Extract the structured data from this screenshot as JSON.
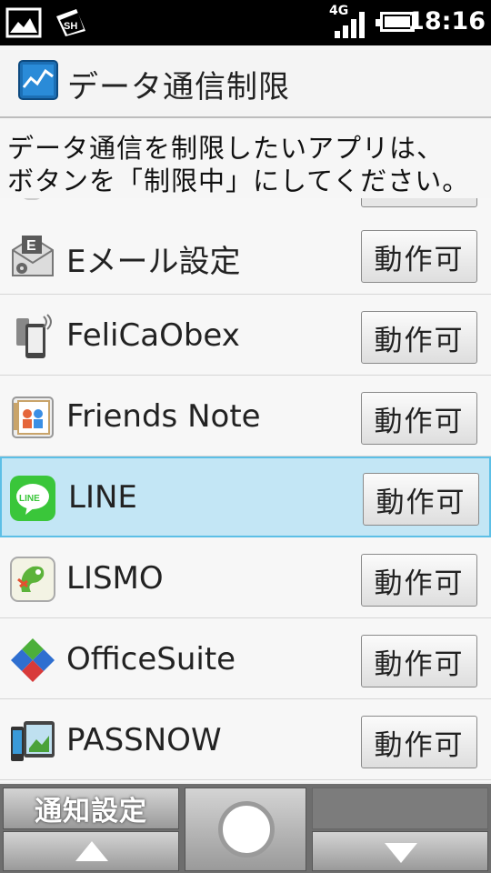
{
  "status_bar": {
    "time": "18:16",
    "network": "4G",
    "icons": [
      "image-notification-icon",
      "sh-notification-icon",
      "signal-icon",
      "battery-icon"
    ]
  },
  "header": {
    "title": "データ通信制限",
    "icon": "data-chart-icon"
  },
  "instructions": {
    "line1": "データ通信を制限したいアプリは、",
    "line2": "ボタンを「制限中」にしてください。"
  },
  "apps": [
    {
      "name": "Eメール設定",
      "button": "動作可",
      "icon": "email-settings-icon"
    },
    {
      "name": "FeliCaObex",
      "button": "動作可",
      "icon": "felica-icon"
    },
    {
      "name": "Friends Note",
      "button": "動作可",
      "icon": "friends-note-icon"
    },
    {
      "name": "LINE",
      "button": "動作可",
      "icon": "line-icon",
      "selected": true
    },
    {
      "name": "LISMO",
      "button": "動作可",
      "icon": "lismo-icon"
    },
    {
      "name": "OfficeSuite",
      "button": "動作可",
      "icon": "officesuite-icon"
    },
    {
      "name": "PASSNOW",
      "button": "動作可",
      "icon": "passnow-icon"
    }
  ],
  "softkeys": {
    "notification_settings": "通知設定",
    "up": "arrow-up-icon",
    "center": "select-circle-icon",
    "down": "arrow-down-icon"
  },
  "colors": {
    "selected_row": "#c3e6f5",
    "selected_border": "#5cbfe6",
    "line_green": "#3ac63a"
  }
}
